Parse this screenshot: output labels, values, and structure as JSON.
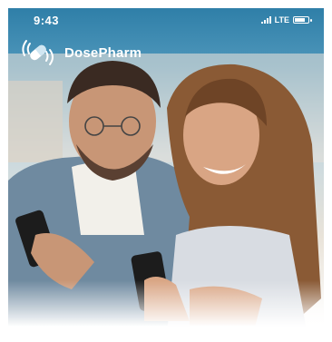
{
  "status_bar": {
    "time": "9:43",
    "network": "LTE"
  },
  "brand": {
    "name": "DosePharm",
    "icon": "pill-signal-icon"
  },
  "hero": {
    "image": "couple-looking-at-phones-photo"
  }
}
